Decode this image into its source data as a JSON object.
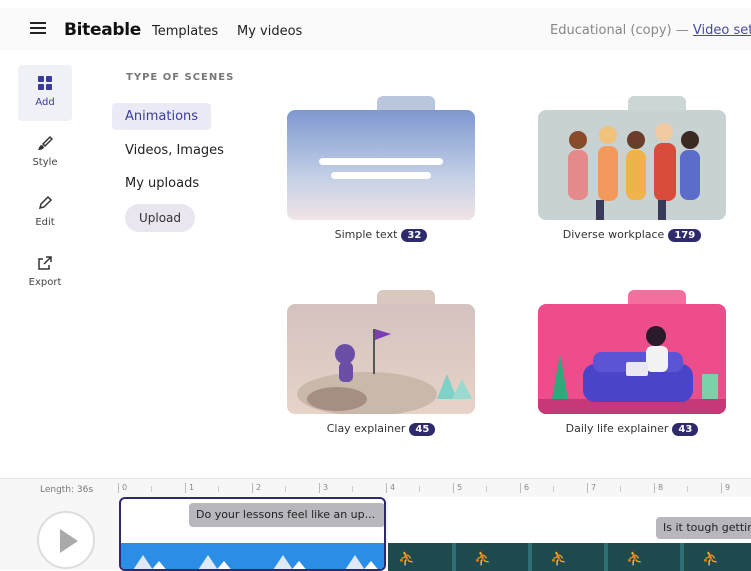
{
  "app": {
    "logo": "Biteable"
  },
  "nav": {
    "templates": "Templates",
    "my_videos": "My videos"
  },
  "breadcrumb": {
    "project": "Educational (copy)",
    "sep": "—",
    "settings_link": "Video set"
  },
  "sidebar": {
    "items": [
      {
        "label": "Add",
        "icon": "grid-icon"
      },
      {
        "label": "Style",
        "icon": "brush-icon"
      },
      {
        "label": "Edit",
        "icon": "pencil-icon"
      },
      {
        "label": "Export",
        "icon": "export-icon"
      }
    ]
  },
  "scenes": {
    "heading": "TYPE OF SCENES",
    "options": [
      "Animations",
      "Videos, Images",
      "My uploads"
    ],
    "upload_label": "Upload"
  },
  "folders": [
    {
      "name": "Simple text",
      "count": "32"
    },
    {
      "name": "Diverse workplace",
      "count": "179"
    },
    {
      "name": "Clay explainer",
      "count": "45"
    },
    {
      "name": "Daily life explainer",
      "count": "43"
    }
  ],
  "timeline": {
    "length": "Length: 36s",
    "ticks": [
      "0",
      "1",
      "2",
      "3",
      "4",
      "5",
      "6",
      "7",
      "8",
      "9"
    ],
    "clip1_text": "Do your lessons feel like an up...",
    "clip2_text": "Is it tough gettin"
  }
}
